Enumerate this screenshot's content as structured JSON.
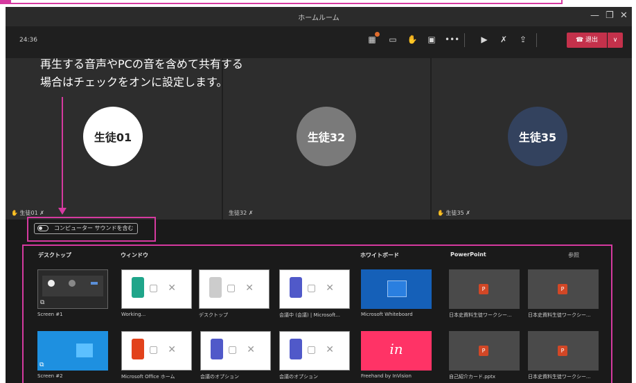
{
  "window": {
    "title": "ホームルーム",
    "minimize_glyph": "—",
    "restore_glyph": "❐",
    "close_glyph": "✕"
  },
  "meeting": {
    "timer": "24:36",
    "leave_label": "退出",
    "leave_caret": "∨",
    "toolbar_icons": [
      "participants-icon",
      "chat-icon",
      "raise-hand-icon",
      "rooms-icon",
      "more-icon",
      "camera-off-icon",
      "mic-off-icon",
      "share-icon"
    ]
  },
  "annotation": {
    "line1": "再生する音声やPCの音を含めて共有する",
    "line2": "場合はチェックをオンに設定します。"
  },
  "participants": [
    {
      "avatar": "生徒01",
      "name": "生徒01",
      "color": "#ffffff",
      "text_color": "#222222"
    },
    {
      "avatar": "生徒32",
      "name": "生徒32",
      "color": "#7a7a7a",
      "text_color": "#ffffff"
    },
    {
      "avatar": "生徒35",
      "name": "生徒35",
      "color": "#33425e",
      "text_color": "#ffffff"
    }
  ],
  "share": {
    "sound_label": "コンピューター サウンドを含む",
    "categories": {
      "desktop": "デスクトップ",
      "window": "ウィンドウ",
      "whiteboard": "ホワイトボード",
      "powerpoint": "PowerPoint",
      "browse": "参照"
    },
    "items": {
      "screen1": "Screen #1",
      "working": "Working...",
      "desktop_win": "デスクトップ",
      "meeting_chat": "会議中 (会議) | Microsoft...",
      "ms_whiteboard": "Microsoft Whiteboard",
      "ppt1": "日本史資料生徒ワークシー...",
      "ppt2": "日本史資料生徒ワークシー...",
      "screen2": "Screen #2",
      "office_home": "Microsoft Office ホーム",
      "meeting_options1": "会議のオプション",
      "meeting_options2": "会議のオプション",
      "freehand": "Freehand by InVision",
      "ppt3": "自己紹介カード.pptx",
      "ppt4": "日本史資料生徒ワークシー..."
    }
  },
  "colors": {
    "highlight": "#d63aa0",
    "leave": "#c4314b",
    "whiteboard": "#1560b8",
    "freehand": "#ff3366",
    "desktop2": "#1e90e0"
  }
}
